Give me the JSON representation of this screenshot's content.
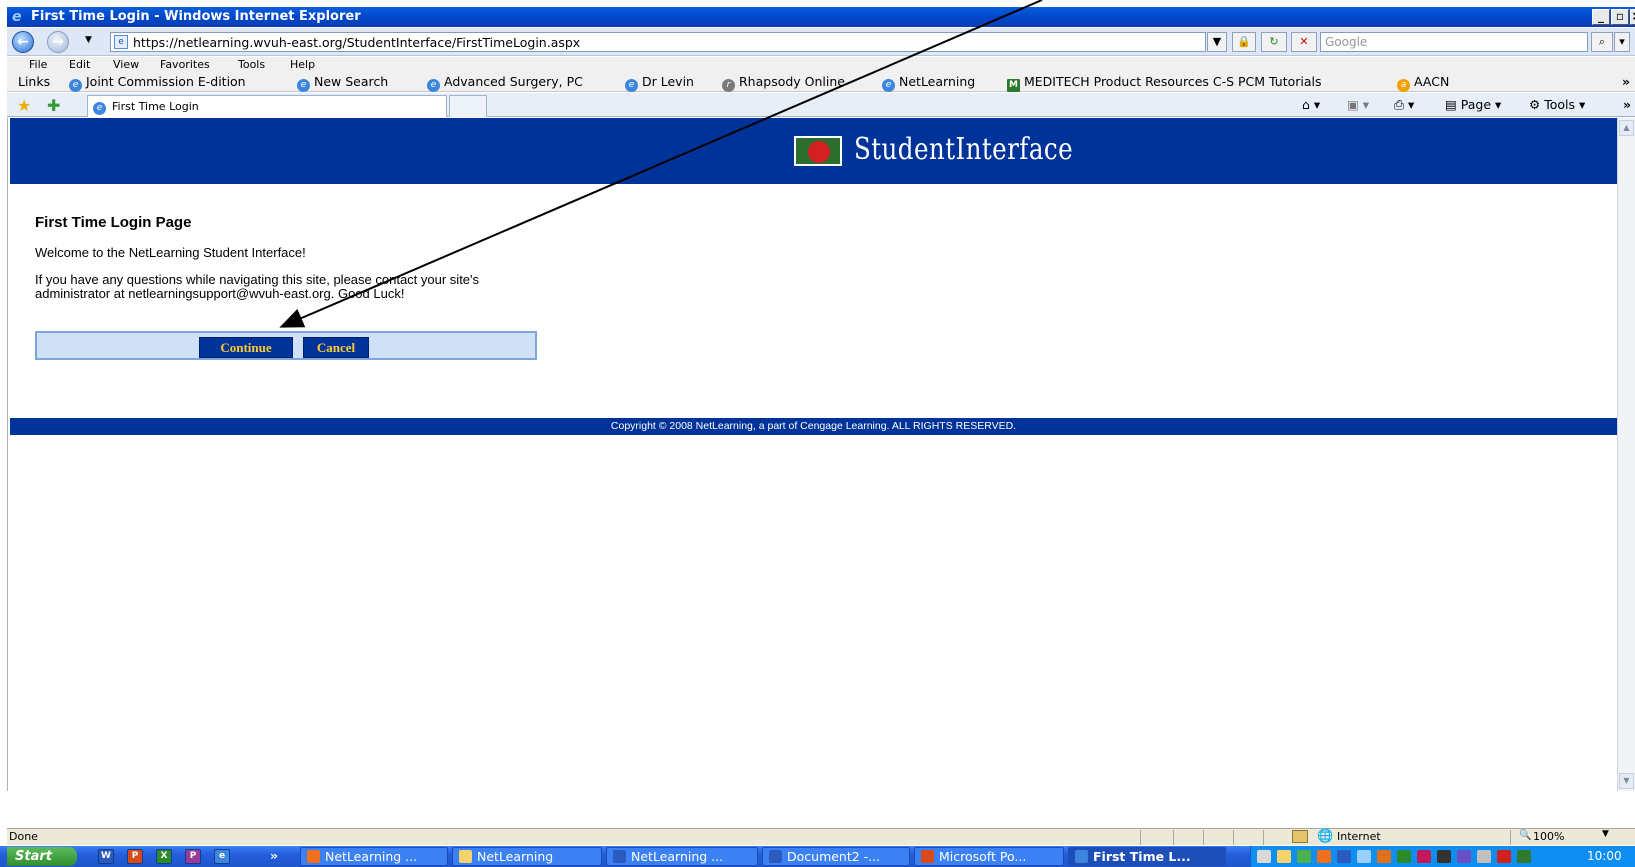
{
  "window": {
    "title": "First Time Login - Windows Internet Explorer",
    "url": "https://netlearning.wvuh-east.org/StudentInterface/FirstTimeLogin.aspx",
    "search_placeholder": "Google"
  },
  "menu": [
    "File",
    "Edit",
    "View",
    "Favorites",
    "Tools",
    "Help"
  ],
  "links_bar": {
    "label": "Links",
    "items": [
      "Joint Commission E-dition",
      "New Search",
      "Advanced Surgery, PC",
      "Dr Levin",
      "Rhapsody Online",
      "NetLearning",
      "MEDITECH Product Resources C-S PCM Tutorials",
      "AACN"
    ]
  },
  "tab": {
    "label": "First Time Login"
  },
  "command_bar": {
    "page_label": "Page",
    "tools_label": "Tools"
  },
  "page": {
    "banner_title": "StudentInterface",
    "heading": "First Time Login Page",
    "welcome": "Welcome to the NetLearning Student Interface!",
    "message": "If you have any questions while navigating this site, please contact your site's administrator at netlearningsupport@wvuh-east.org. Good Luck!",
    "continue_label": "Continue",
    "cancel_label": "Cancel",
    "copyright": "Copyright © 2008 NetLearning, a part of Cengage Learning. ALL RIGHTS RESERVED."
  },
  "status_bar": {
    "status": "Done",
    "zone": "Internet",
    "zoom": "100%"
  },
  "taskbar": {
    "start_label": "Start",
    "tasks": [
      "NetLearning ...",
      "NetLearning",
      "NetLearning ...",
      "Document2 -...",
      "Microsoft Po...",
      "First Time L..."
    ],
    "clock": "10:00"
  },
  "colors": {
    "banner": "#003399",
    "button_text": "#ffcc33",
    "panel": "#cfe0f7"
  }
}
